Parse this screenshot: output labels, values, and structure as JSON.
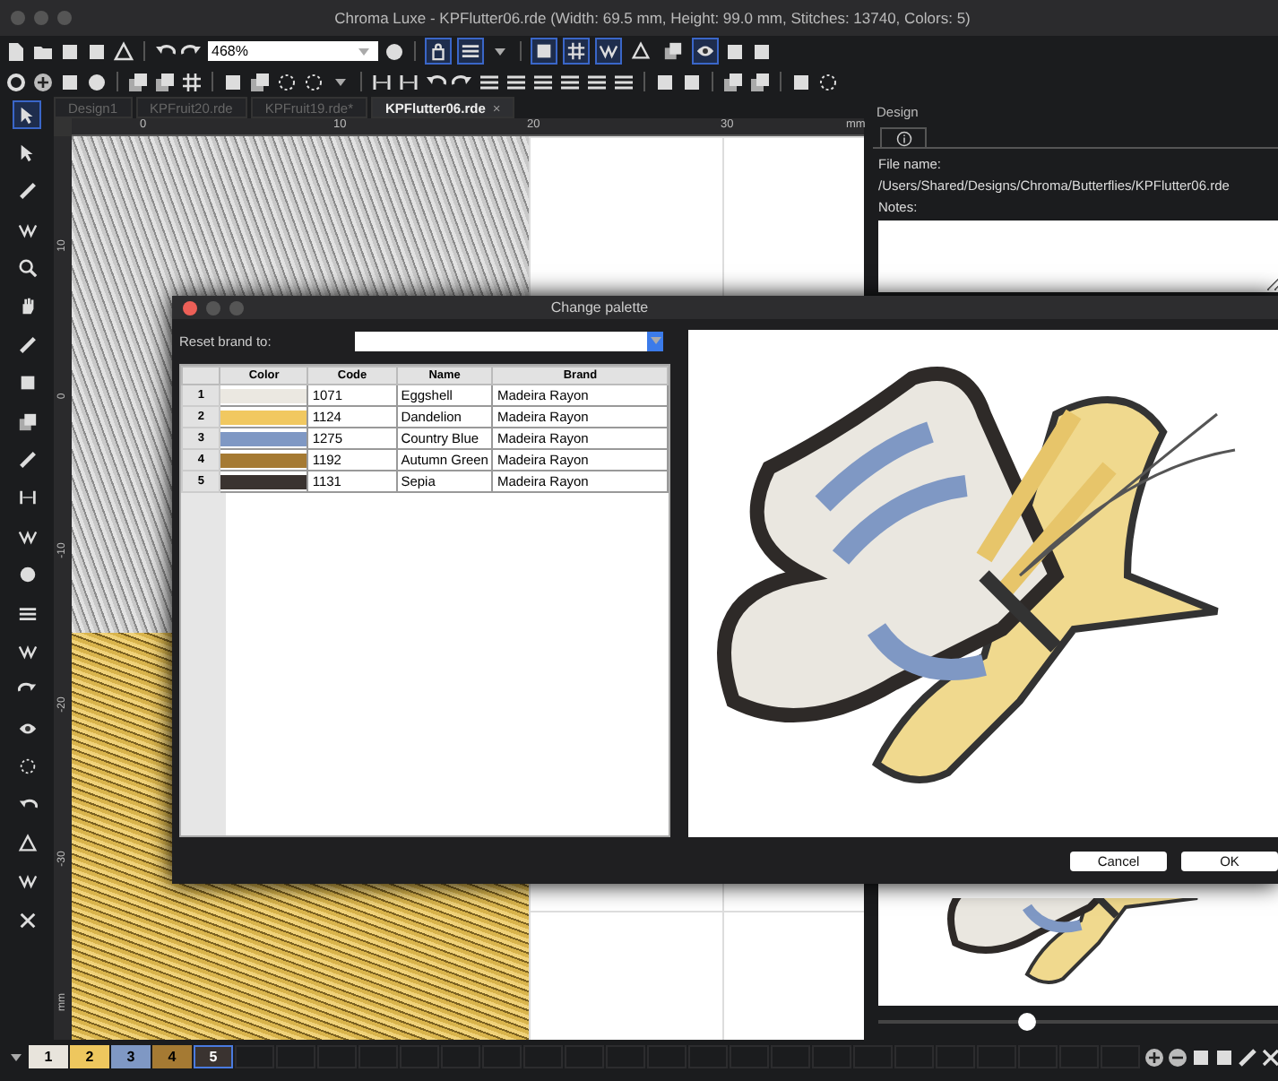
{
  "window": {
    "title": "Chroma Luxe - KPFlutter06.rde (Width: 69.5 mm, Height: 99.0 mm, Stitches: 13740, Colors: 5)"
  },
  "toolbar": {
    "zoom": "468%",
    "toggle_buttons": [
      {
        "on": true
      },
      {
        "on": true
      },
      {
        "on": true
      },
      {
        "on": true
      },
      {
        "on": true
      },
      {
        "on": false
      },
      {
        "on": false
      },
      {
        "on": true
      }
    ]
  },
  "tools": [
    {
      "selected": true
    },
    {
      "selected": false
    },
    {
      "selected": false
    },
    {
      "selected": false
    },
    {
      "selected": false
    },
    {
      "selected": false
    },
    {
      "selected": false
    },
    {
      "selected": false
    },
    {
      "selected": false
    },
    {
      "selected": false
    },
    {
      "selected": false
    },
    {
      "selected": false
    },
    {
      "selected": false
    },
    {
      "selected": false
    },
    {
      "selected": false
    },
    {
      "selected": false
    },
    {
      "selected": false
    },
    {
      "selected": false
    },
    {
      "selected": false
    },
    {
      "selected": false
    },
    {
      "selected": false
    },
    {
      "selected": false
    }
  ],
  "tabs": [
    {
      "label": "Design1",
      "selected": false
    },
    {
      "label": "KPFruit20.rde",
      "selected": false
    },
    {
      "label": "KPFruit19.rde*",
      "selected": false
    },
    {
      "label": "KPFlutter06.rde",
      "selected": true,
      "close": "×"
    }
  ],
  "ruler": {
    "horizontal": [
      "0",
      "10",
      "20",
      "30",
      "mm"
    ],
    "vertical": [
      "10",
      "0",
      "-10",
      "-20",
      "-30",
      "mm"
    ]
  },
  "design_panel": {
    "title": "Design",
    "file_name_label": "File name:",
    "file_name": "/Users/Shared/Designs/Chroma/Butterflies/KPFlutter06.rde",
    "notes_label": "Notes:",
    "slider": {
      "level": 0.37
    }
  },
  "palette_bar": [
    {
      "label": "1",
      "color": "#e8e4dc",
      "selected": false
    },
    {
      "label": "2",
      "color": "#eec75e",
      "selected": false
    },
    {
      "label": "3",
      "color": "#7f98c4",
      "selected": false
    },
    {
      "label": "4",
      "color": "#a57a33",
      "selected": false
    },
    {
      "label": "5",
      "color": "#3a3330",
      "selected": true
    }
  ],
  "dialog": {
    "title": "Change palette",
    "reset_label": "Reset brand to:",
    "columns": [
      "Color",
      "Code",
      "Name",
      "Brand"
    ],
    "rows": [
      {
        "number": "1",
        "color": "#ebe8e1",
        "code": "1071",
        "name": "Eggshell",
        "brand": "Madeira Rayon"
      },
      {
        "number": "2",
        "color": "#f1c860",
        "code": "1124",
        "name": "Dandelion",
        "brand": "Madeira Rayon"
      },
      {
        "number": "3",
        "color": "#7f98c4",
        "code": "1275",
        "name": "Country Blue",
        "brand": "Madeira Rayon"
      },
      {
        "number": "4",
        "color": "#a57a33",
        "code": "1192",
        "name": "Autumn Green",
        "brand": "Madeira Rayon"
      },
      {
        "number": "5",
        "color": "#3a3330",
        "code": "1131",
        "name": "Sepia",
        "brand": "Madeira Rayon"
      }
    ],
    "buttons": [
      "Cancel",
      "OK"
    ]
  }
}
